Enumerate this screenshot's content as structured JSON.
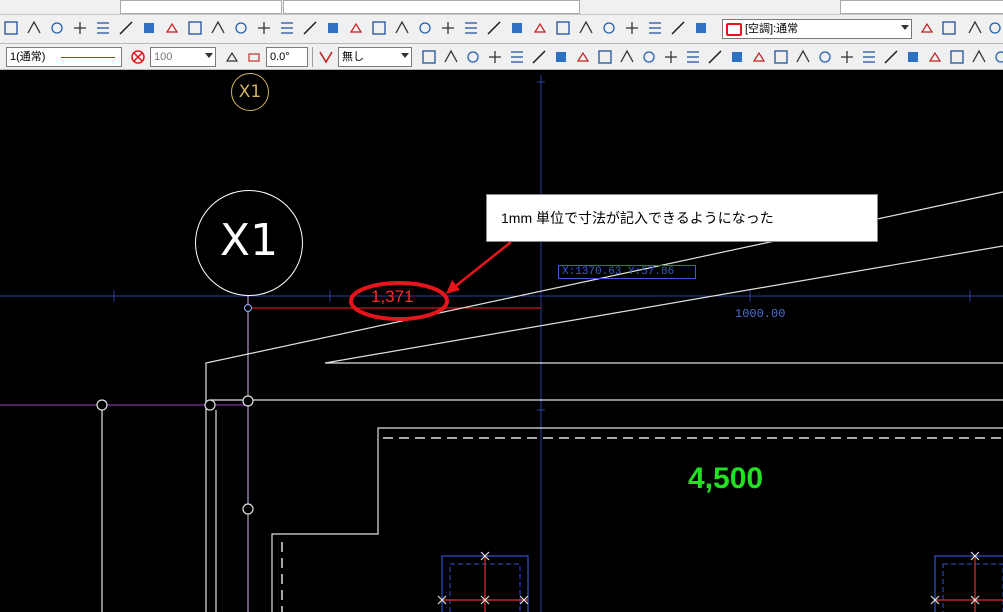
{
  "toolbar": {
    "layer_combo": "1(通常)",
    "line_weight": "100",
    "angle": "0.0°",
    "fill_combo": "無し",
    "print_combo": "[空調]:通常"
  },
  "drawing": {
    "grid_label_big": "X1",
    "grid_label_small": "X1",
    "dimension_red": "1,371",
    "dimension_green": "4,500",
    "dimension_blue": "1000.00",
    "coordinate_readout": "X:1370.63 Y:57.86",
    "callout_text": "1mm 単位で寸法が記入できるようになった"
  },
  "colors": {
    "canvas_bg": "#000000",
    "annotation_red": "#e8141c",
    "dim_green": "#22e022",
    "guide_blue": "#3a5ed0",
    "guide_purple": "#a040c8"
  }
}
